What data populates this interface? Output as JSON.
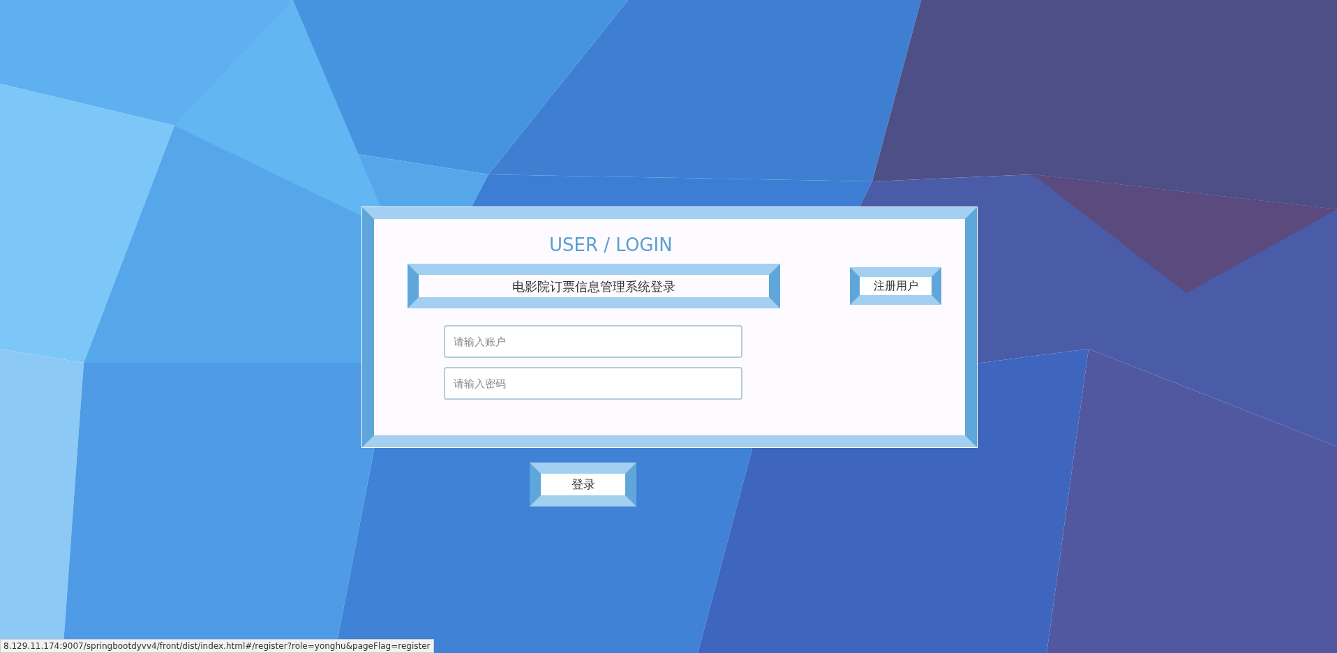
{
  "login_card": {
    "heading": "USER / LOGIN",
    "system_title": "电影院订票信息管理系统登录",
    "register_button": "注册用户",
    "fields": [
      {
        "placeholder": "请输入账户"
      },
      {
        "placeholder": "请输入密码"
      }
    ]
  },
  "login_button": "登录",
  "status_bar": {
    "url": "8.129.11.174:9007/springbootdyvv4/front/dist/index.html#/register?role=yonghu&pageFlag=register"
  }
}
